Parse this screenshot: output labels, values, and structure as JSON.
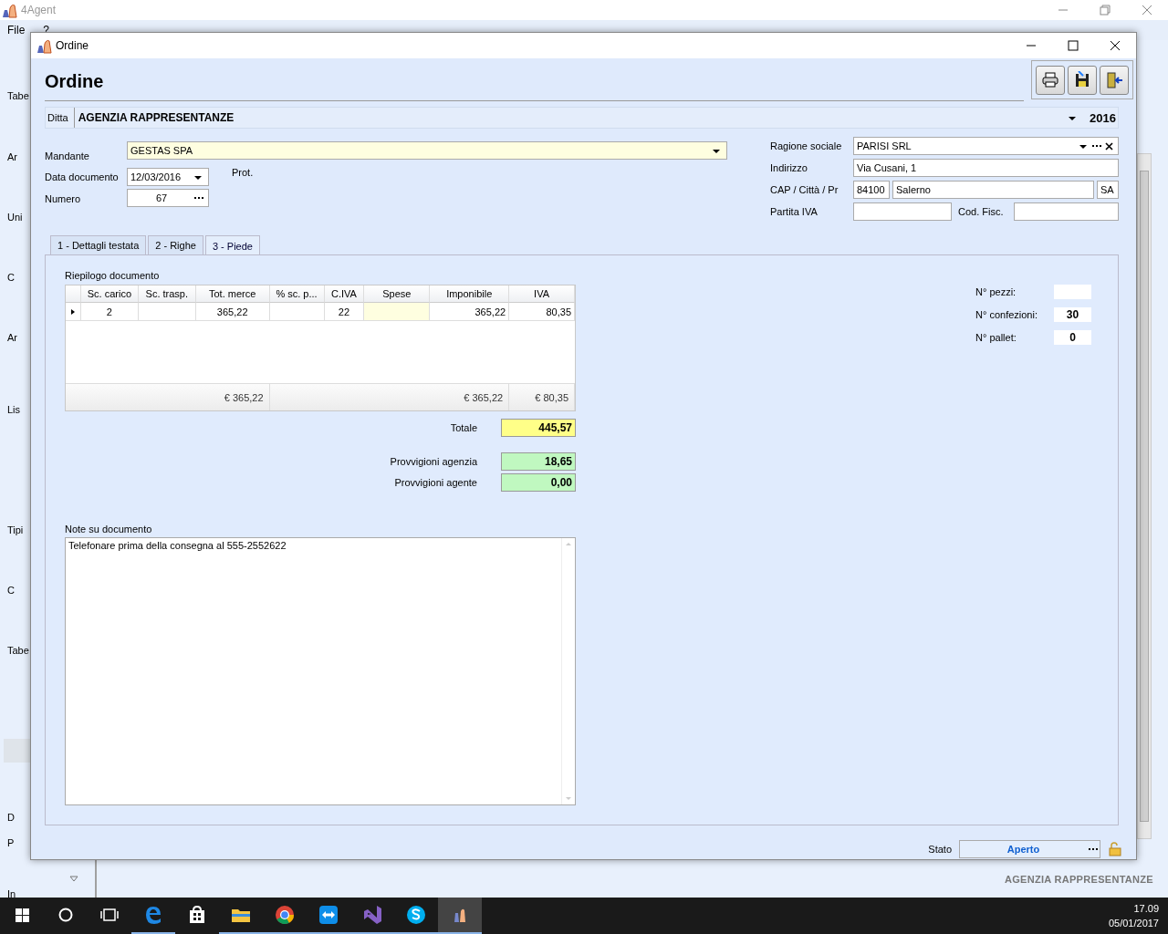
{
  "background_app": {
    "title": "4Agent",
    "menu": [
      "File",
      "?"
    ],
    "sidebar_items": [
      "Tabe",
      "Ar",
      "Uni",
      "C",
      "Ar",
      "Lis",
      "Tipi",
      "C",
      "Tabe",
      "D",
      "P",
      "In"
    ],
    "footer": "AGENZIA RAPPRESENTANZE"
  },
  "dialog": {
    "title": "Ordine",
    "heading": "Ordine",
    "ditta": {
      "label": "Ditta",
      "value": "AGENZIA RAPPRESENTANZE",
      "year": "2016"
    },
    "mandante": {
      "label": "Mandante",
      "value": "GESTAS SPA"
    },
    "data_documento": {
      "label": "Data documento",
      "value": "12/03/2016"
    },
    "prot": {
      "label": "Prot."
    },
    "numero": {
      "label": "Numero",
      "value": "67"
    },
    "customer": {
      "ragione_sociale": {
        "label": "Ragione sociale",
        "value": "PARISI SRL"
      },
      "indirizzo": {
        "label": "Indirizzo",
        "value": "Via Cusani, 1"
      },
      "cap_citta_pr": {
        "label": "CAP / Città / Pr",
        "cap": "84100",
        "citta": "Salerno",
        "pr": "SA"
      },
      "partita_iva": {
        "label": "Partita IVA"
      },
      "cod_fisc": {
        "label": "Cod. Fisc."
      }
    },
    "tabs": [
      {
        "label": "1 - Dettagli testata",
        "selected": false
      },
      {
        "label": "2 - Righe",
        "selected": false
      },
      {
        "label": "3 - Piede",
        "selected": true
      }
    ],
    "summary": {
      "title": "Riepilogo documento",
      "columns": [
        "Sc. carico",
        "Sc. trasp.",
        "Tot. merce",
        "% sc. p...",
        "C.IVA",
        "Spese",
        "Imponibile",
        "IVA"
      ],
      "rows": [
        {
          "selected": true,
          "cells": [
            "2",
            "",
            "365,22",
            "",
            "22",
            "",
            "365,22",
            "80,35"
          ]
        }
      ],
      "footer": [
        "€ 365,22",
        "€ 365,22",
        "€ 80,35"
      ]
    },
    "totals": [
      {
        "label": "Totale",
        "value": "445,57",
        "kind": "total"
      },
      {
        "label": "Provvigioni agenzia",
        "value": "18,65",
        "kind": "commission"
      },
      {
        "label": "Provvigioni agente",
        "value": "0,00",
        "kind": "commission"
      }
    ],
    "counts": [
      {
        "label": "N° pezzi:"
      },
      {
        "label": "N° confezioni:",
        "value": "30"
      },
      {
        "label": "N° pallet:",
        "value": "0"
      }
    ],
    "notes": {
      "label": "Note su documento",
      "value": "Telefonare prima della consegna al 555-2552622"
    },
    "status": {
      "label": "Stato",
      "value": "Aperto"
    }
  },
  "taskbar": {
    "apps": [
      {
        "kind": "edge",
        "running": true,
        "selected": false
      },
      {
        "kind": "store",
        "running": false,
        "selected": false
      },
      {
        "kind": "explorer",
        "running": true,
        "selected": false
      },
      {
        "kind": "chrome",
        "running": true,
        "selected": false
      },
      {
        "kind": "teamviewer",
        "running": true,
        "selected": false
      },
      {
        "kind": "studio",
        "running": true,
        "selected": false
      },
      {
        "kind": "skype",
        "running": true,
        "selected": false
      },
      {
        "kind": "fouragent",
        "running": true,
        "selected": true
      }
    ],
    "time": "17.09",
    "date": "05/01/2017"
  }
}
